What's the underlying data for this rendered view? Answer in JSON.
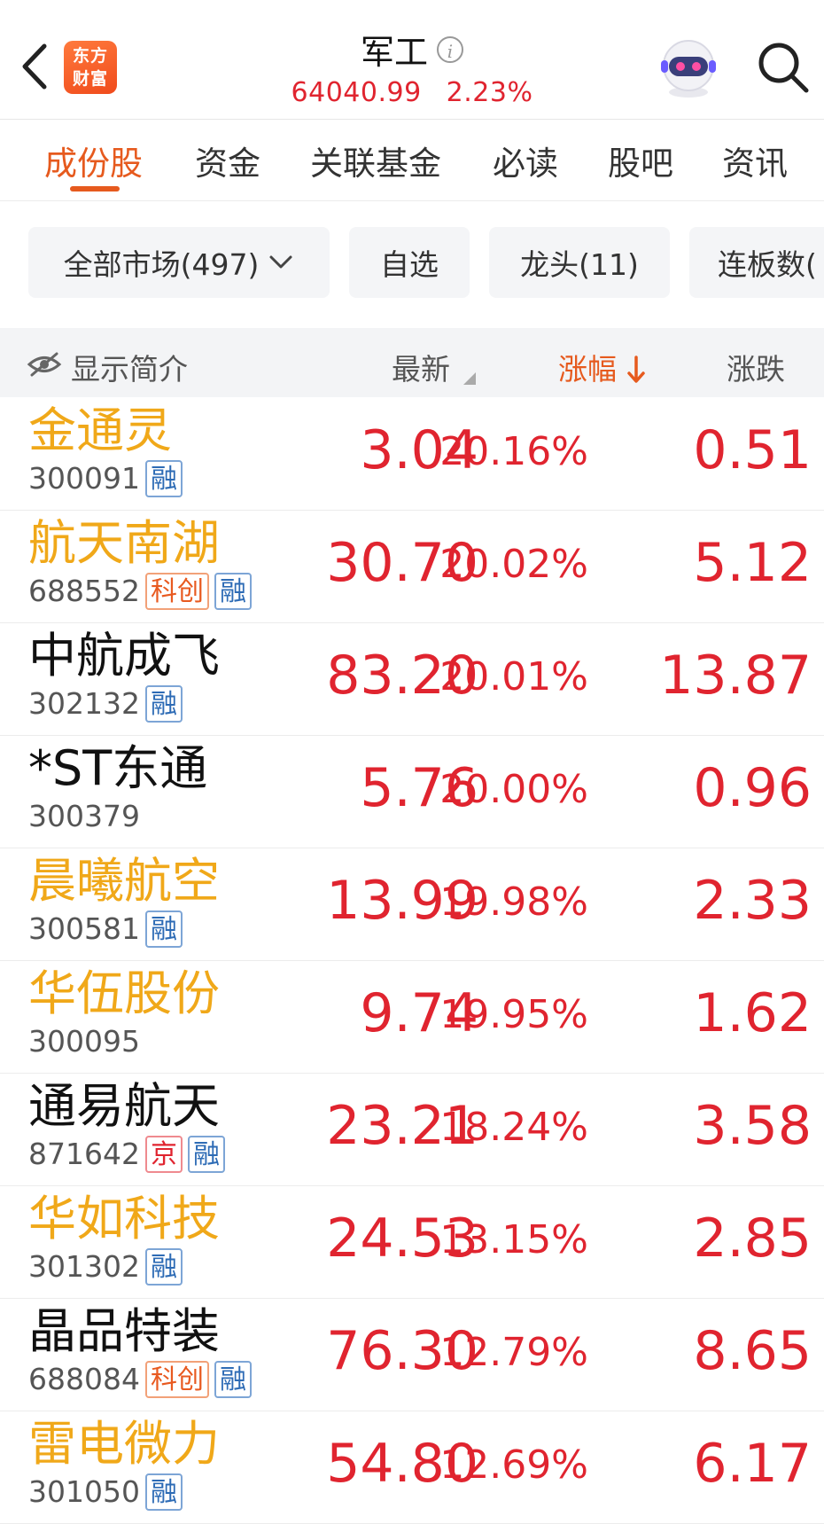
{
  "header": {
    "logo_line1": "东方",
    "logo_line2": "财富",
    "title": "军工",
    "index_value": "64040.99",
    "index_change": "2.23%"
  },
  "icons": [
    "back-arrow-icon",
    "info-icon",
    "robot-assistant-icon",
    "search-icon",
    "eye-off-icon",
    "chevron-down-icon",
    "sort-triangle-icon",
    "sort-down-arrow-icon"
  ],
  "colors": {
    "accent": "#e65a1e",
    "up_red": "#e0242f",
    "highlight_yellow": "#f0a819",
    "rong_blue": "#2d6bb5"
  },
  "tabs": [
    {
      "label": "成份股",
      "active": true
    },
    {
      "label": "资金"
    },
    {
      "label": "关联基金"
    },
    {
      "label": "必读"
    },
    {
      "label": "股吧"
    },
    {
      "label": "资讯"
    }
  ],
  "filters": [
    {
      "label": "全部市场(497)"
    },
    {
      "label": "自选"
    },
    {
      "label": "龙头(11)"
    },
    {
      "label": "连板数("
    }
  ],
  "columns": {
    "toggle": "显示简介",
    "latest": "最新",
    "change_pct": "涨幅",
    "change": "涨跌"
  },
  "rows": [
    {
      "name": "金通灵",
      "code": "300091",
      "badges": [
        "融"
      ],
      "price": "3.04",
      "pct": "20.16%",
      "chg": "0.51",
      "name_color": "yellow"
    },
    {
      "name": "航天南湖",
      "code": "688552",
      "badges": [
        "科创",
        "融"
      ],
      "price": "30.70",
      "pct": "20.02%",
      "chg": "5.12",
      "name_color": "yellow"
    },
    {
      "name": "中航成飞",
      "code": "302132",
      "badges": [
        "融"
      ],
      "price": "83.20",
      "pct": "20.01%",
      "chg": "13.87",
      "name_color": "black"
    },
    {
      "name": "*ST东通",
      "code": "300379",
      "badges": [],
      "price": "5.76",
      "pct": "20.00%",
      "chg": "0.96",
      "name_color": "black"
    },
    {
      "name": "晨曦航空",
      "code": "300581",
      "badges": [
        "融"
      ],
      "price": "13.99",
      "pct": "19.98%",
      "chg": "2.33",
      "name_color": "yellow"
    },
    {
      "name": "华伍股份",
      "code": "300095",
      "badges": [],
      "price": "9.74",
      "pct": "19.95%",
      "chg": "1.62",
      "name_color": "yellow"
    },
    {
      "name": "通易航天",
      "code": "871642",
      "badges": [
        "京",
        "融"
      ],
      "price": "23.21",
      "pct": "18.24%",
      "chg": "3.58",
      "name_color": "black"
    },
    {
      "name": "华如科技",
      "code": "301302",
      "badges": [
        "融"
      ],
      "price": "24.53",
      "pct": "13.15%",
      "chg": "2.85",
      "name_color": "yellow"
    },
    {
      "name": "晶品特装",
      "code": "688084",
      "badges": [
        "科创",
        "融"
      ],
      "price": "76.30",
      "pct": "12.79%",
      "chg": "8.65",
      "name_color": "black"
    },
    {
      "name": "雷电微力",
      "code": "301050",
      "badges": [
        "融"
      ],
      "price": "54.80",
      "pct": "12.69%",
      "chg": "6.17",
      "name_color": "yellow"
    }
  ]
}
